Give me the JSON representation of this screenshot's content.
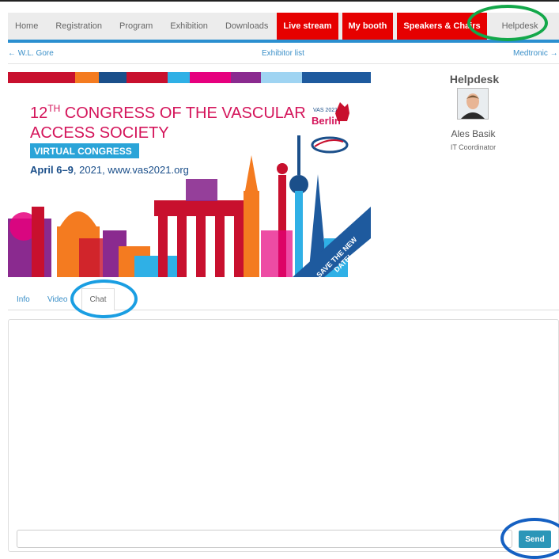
{
  "nav": {
    "items": [
      {
        "label": "Home"
      },
      {
        "label": "Registration"
      },
      {
        "label": "Program"
      },
      {
        "label": "Exhibition"
      },
      {
        "label": "Downloads"
      },
      {
        "label": "Live stream"
      },
      {
        "label": "My booth"
      },
      {
        "label": "Speakers & Chairs"
      },
      {
        "label": "Helpdesk"
      }
    ]
  },
  "subnav": {
    "prev": "← W.L. Gore",
    "center": "Exhibitor list",
    "next": "Medtronic →"
  },
  "banner": {
    "title_num": "12",
    "title_sup": "TH",
    "title_line1_rest": " CONGRESS OF THE VASCULAR",
    "title_line2": "ACCESS SOCIETY",
    "badge": "VIRTUAL CONGRESS",
    "date_bold": "April 6–9",
    "date_rest": ", 2021, www.vas2021.org",
    "logo_top": "VAS 2021",
    "logo_mid": "Berlin",
    "ribbon_line1": "SAVE THE NEW",
    "ribbon_line2": "DATE!"
  },
  "helpdesk": {
    "title": "Helpdesk",
    "name": "Ales Basik",
    "role": "IT Coordinator"
  },
  "tabs": {
    "info": "Info",
    "video": "Video",
    "chat": "Chat"
  },
  "chat": {
    "input_value": "",
    "send_label": "Send"
  },
  "colors": {
    "nav_red": "#e60000",
    "accent_blue": "#2b8fd0",
    "send_button": "#2b96b8",
    "highlight_green": "#13a84a",
    "highlight_blue": "#1a9ee2"
  }
}
